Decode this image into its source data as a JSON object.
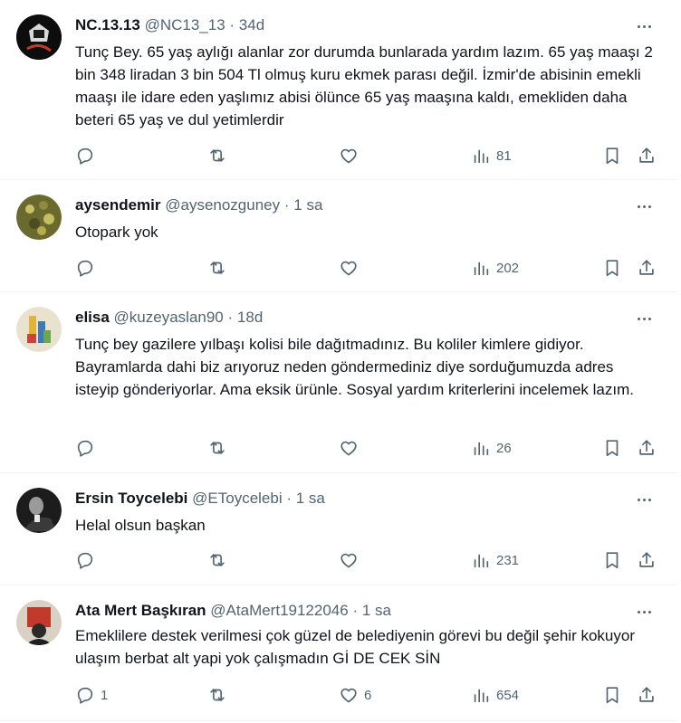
{
  "tweets": [
    {
      "name": "NC.13.13",
      "handle": "@NC13_13",
      "dot": "·",
      "time": "34d",
      "text": "Tunç Bey. 65 yaş aylığı alanlar zor durumda bunlarada yardım lazım. 65 yaş maaşı 2 bin 348 liradan 3 bin 504 Tl olmuş kuru ekmek parası değil. İzmir'de abisinin emekli maaşı ile idare eden yaşlımız abisi ölünce 65 yaş maaşına kaldı, emekliden daha beteri 65 yaş ve dul yetimlerdir",
      "replies": "",
      "retweets": "",
      "likes": "",
      "views": "81"
    },
    {
      "name": "aysendemir",
      "handle": "@aysenozguney",
      "dot": "·",
      "time": "1 sa",
      "text": "Otopark yok",
      "replies": "",
      "retweets": "",
      "likes": "",
      "views": "202"
    },
    {
      "name": "elisa",
      "handle": "@kuzeyaslan90",
      "dot": "·",
      "time": "18d",
      "text": "Tunç bey gazilere yılbaşı kolisi bile dağıtmadınız. Bu koliler kimlere gidiyor. Bayramlarda dahi biz arıyoruz neden göndermediniz diye sorduğumuzda adres isteyip gönderiyorlar. Ama eksik ürünle. Sosyal yardım kriterlerini incelemek lazım.",
      "replies": "",
      "retweets": "",
      "likes": "",
      "views": "26"
    },
    {
      "name": "Ersin Toycelebi",
      "handle": "@EToycelebi",
      "dot": "·",
      "time": "1 sa",
      "text": "Helal olsun başkan",
      "replies": "",
      "retweets": "",
      "likes": "",
      "views": "231"
    },
    {
      "name": "Ata Mert Başkıran",
      "handle": "@AtaMert19122046",
      "dot": "·",
      "time": "1 sa",
      "text": "Emeklilere destek verilmesi çok güzel de belediyenin görevi bu değil şehir kokuyor ulaşım berbat alt yapi yok çalışmadın Gİ DE CEK SİN",
      "replies": "1",
      "retweets": "",
      "likes": "6",
      "views": "654"
    }
  ],
  "icons": {
    "reply": "reply-icon",
    "retweet": "retweet-icon",
    "like": "like-icon",
    "views": "views-icon",
    "bookmark": "bookmark-icon",
    "share": "share-icon",
    "more": "more-icon"
  },
  "colors": {
    "text": "#0f1419",
    "secondary": "#536471",
    "divider": "#eff3f4"
  }
}
